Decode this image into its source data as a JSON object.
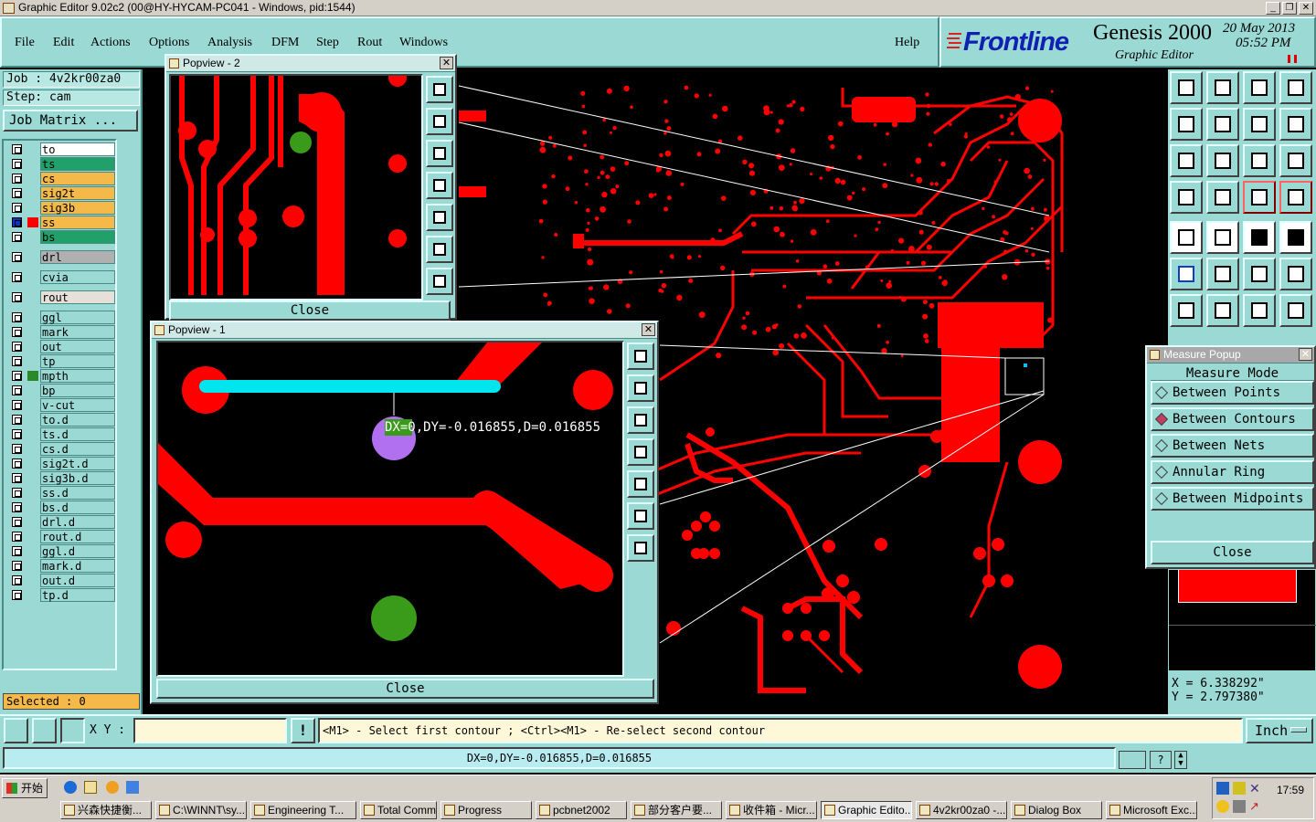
{
  "window": {
    "title": "Graphic Editor 9.02c2 (00@HY-HYCAM-PC041 - Windows, pid:1544)",
    "minimize": "_",
    "restore": "❐",
    "close": "✕"
  },
  "menu": [
    "File",
    "Edit",
    "Actions",
    "Options",
    "Analysis",
    "DFM",
    "Step",
    "Rout",
    "Windows"
  ],
  "help": "Help",
  "brand": {
    "logo": "Frontline",
    "product": "Genesis 2000",
    "subtitle": "Graphic Editor",
    "date": "20 May 2013",
    "time": "05:52 PM"
  },
  "job": {
    "job_label": "Job : 4v2kr00za0",
    "step_label": "Step: cam",
    "matrix_button": "Job Matrix ..."
  },
  "layers": [
    {
      "name": "to",
      "color": "#ffffff"
    },
    {
      "name": "ts",
      "color": "#22a06a"
    },
    {
      "name": "cs",
      "color": "#f5b94a"
    },
    {
      "name": "sig2t",
      "color": "#f5b94a"
    },
    {
      "name": "sig3b",
      "color": "#f5b94a"
    },
    {
      "name": "ss",
      "color": "#f5b94a"
    },
    {
      "name": "bs",
      "color": "#22a06a"
    },
    {
      "name": "drl",
      "color": "#b0b0b0"
    },
    {
      "name": "cvia",
      "color": "#9ad9d4"
    },
    {
      "name": "rout",
      "color": "#e6e0d8"
    },
    {
      "name": "ggl",
      "color": "#9ad9d4"
    },
    {
      "name": "mark",
      "color": "#9ad9d4"
    },
    {
      "name": "out",
      "color": "#9ad9d4"
    },
    {
      "name": "tp",
      "color": "#9ad9d4"
    },
    {
      "name": "mpth",
      "color": "#9ad9d4"
    },
    {
      "name": "bp",
      "color": "#9ad9d4"
    },
    {
      "name": "v-cut",
      "color": "#9ad9d4"
    },
    {
      "name": "to.d",
      "color": "#9ad9d4"
    },
    {
      "name": "ts.d",
      "color": "#9ad9d4"
    },
    {
      "name": "cs.d",
      "color": "#9ad9d4"
    },
    {
      "name": "sig2t.d",
      "color": "#9ad9d4"
    },
    {
      "name": "sig3b.d",
      "color": "#9ad9d4"
    },
    {
      "name": "ss.d",
      "color": "#9ad9d4"
    },
    {
      "name": "bs.d",
      "color": "#9ad9d4"
    },
    {
      "name": "drl.d",
      "color": "#9ad9d4"
    },
    {
      "name": "rout.d",
      "color": "#9ad9d4"
    },
    {
      "name": "ggl.d",
      "color": "#9ad9d4"
    },
    {
      "name": "mark.d",
      "color": "#9ad9d4"
    },
    {
      "name": "out.d",
      "color": "#9ad9d4"
    },
    {
      "name": "tp.d",
      "color": "#9ad9d4"
    }
  ],
  "selected": "Selected : 0",
  "popview2": {
    "title": "Popview - 2",
    "close": "Close"
  },
  "popview1": {
    "title": "Popview - 1",
    "close": "Close",
    "measure_label": "DX=0,DY=-0.016855,D=0.016855"
  },
  "measure_popup": {
    "title": "Measure Popup",
    "mode_header": "Measure Mode",
    "options": [
      "Between Points",
      "Between Contours",
      "Between Nets",
      "Annular Ring",
      "Between Midpoints"
    ],
    "selected_option": "Between Contours",
    "close": "Close"
  },
  "coords": {
    "x": "X =  6.338292\"",
    "y": "Y =  2.797380\""
  },
  "command": {
    "xy_label": "X Y :",
    "xy_value": "",
    "hint": "<M1> - Select first contour ; <Ctrl><M1> - Re-select second contour",
    "unit": "Inch"
  },
  "status_text": "DX=0,DY=-0.016855,D=0.016855",
  "taskbar": {
    "start": "开始",
    "clock": "17:59",
    "tasks": [
      "兴森快捷衡...",
      "C:\\WINNT\\sy...",
      "Engineering T...",
      "Total Comma...",
      "Progress",
      "pcbnet2002",
      "部分客户要...",
      "收件箱 - Micr...",
      "Graphic Edito...",
      "4v2kr00za0 -...",
      "Dialog Box",
      "Microsoft Exc..."
    ],
    "active_task": "Graphic Edito..."
  },
  "colors": {
    "panel": "#9ad9d4",
    "copper": "#ff0000",
    "measure_line": "#00e5ee",
    "pad_green": "#3a9a1a",
    "pad_violet": "#b070f0"
  }
}
